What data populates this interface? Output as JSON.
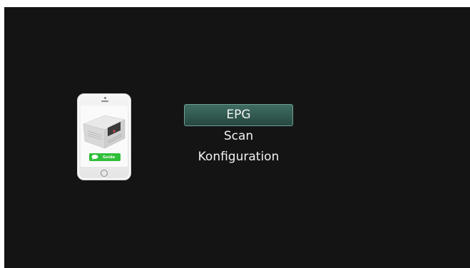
{
  "menu": {
    "items": [
      {
        "label": "EPG",
        "selected": true
      },
      {
        "label": "Scan",
        "selected": false
      },
      {
        "label": "Konfiguration",
        "selected": false
      }
    ]
  },
  "phone": {
    "guide_label": "Guide",
    "icons": [
      "phone-icon",
      "chat-icon",
      "booklet-image"
    ]
  },
  "colors": {
    "background": "#141414",
    "selected_item": "#335a51",
    "selected_border": "#6f9e94",
    "text": "#f2f2f2",
    "guide_green": "#2fbf3a"
  }
}
